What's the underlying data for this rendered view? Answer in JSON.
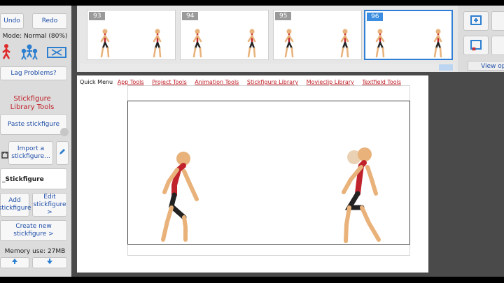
{
  "left_panel": {
    "undo": "Undo",
    "redo": "Redo",
    "mode": "Mode: Normal (80%)",
    "lag": "Lag Problems?",
    "library_title": "Stickfigure Library Tools",
    "paste": "Paste stickfigure",
    "import": "Import a stickfigure...",
    "name_value": "_Stickfigure",
    "add": "Add stickfigure",
    "edit": "Edit stickfigure >",
    "create": "Create new stickfigure >",
    "memory": "Memory use: 27MB"
  },
  "frames": [
    "93",
    "94",
    "95",
    "96"
  ],
  "selected_frame": "96",
  "right_tools": {
    "view": "View opti"
  },
  "menu": {
    "quick": "Quick Menu",
    "items": [
      "App Tools",
      "Project Tools",
      "Animation Tools",
      "Stickfigure Library",
      "Movieclip Library",
      "Textfield Tools"
    ]
  },
  "colors": {
    "accent_red": "#c0232b",
    "selection_blue": "#2f7fd6",
    "skin": "#e8b27a"
  },
  "icons": [
    "stickfigure-icon",
    "group-icon",
    "movieclip-icon",
    "pencil-icon",
    "arrow-up-icon",
    "arrow-down-icon"
  ]
}
